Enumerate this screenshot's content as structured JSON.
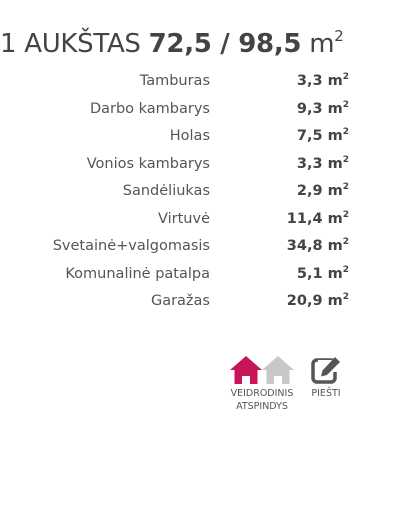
{
  "floor": {
    "label": "1 AUKŠTAS",
    "area": "72,5 / 98,5",
    "unit": "m",
    "unit_sup": "2"
  },
  "area_sup": "2",
  "rooms": [
    {
      "name": "Tamburas",
      "area": "3,3 m"
    },
    {
      "name": "Darbo kambarys",
      "area": "9,3 m"
    },
    {
      "name": "Holas",
      "area": "7,5 m"
    },
    {
      "name": "Vonios kambarys",
      "area": "3,3 m"
    },
    {
      "name": "Sandėliukas",
      "area": "2,9 m"
    },
    {
      "name": "Virtuvė",
      "area": "11,4 m"
    },
    {
      "name": "Svetainė+valgomasis",
      "area": "34,8 m"
    },
    {
      "name": "Komunalinė patalpa",
      "area": "5,1 m"
    },
    {
      "name": "Garažas",
      "area": "20,9 m"
    }
  ],
  "actions": {
    "mirror_label": "VEIDRODINIS\nATSPINDYS",
    "draw_label": "PIEŠTI"
  },
  "icons": {
    "mirror": "mirror-houses-icon",
    "draw": "edit-pencil-icon"
  },
  "colors": {
    "accent": "#c8155a",
    "inactive": "#c8c8c8",
    "icon_dark": "#555555",
    "text": "#4a4a4a"
  }
}
